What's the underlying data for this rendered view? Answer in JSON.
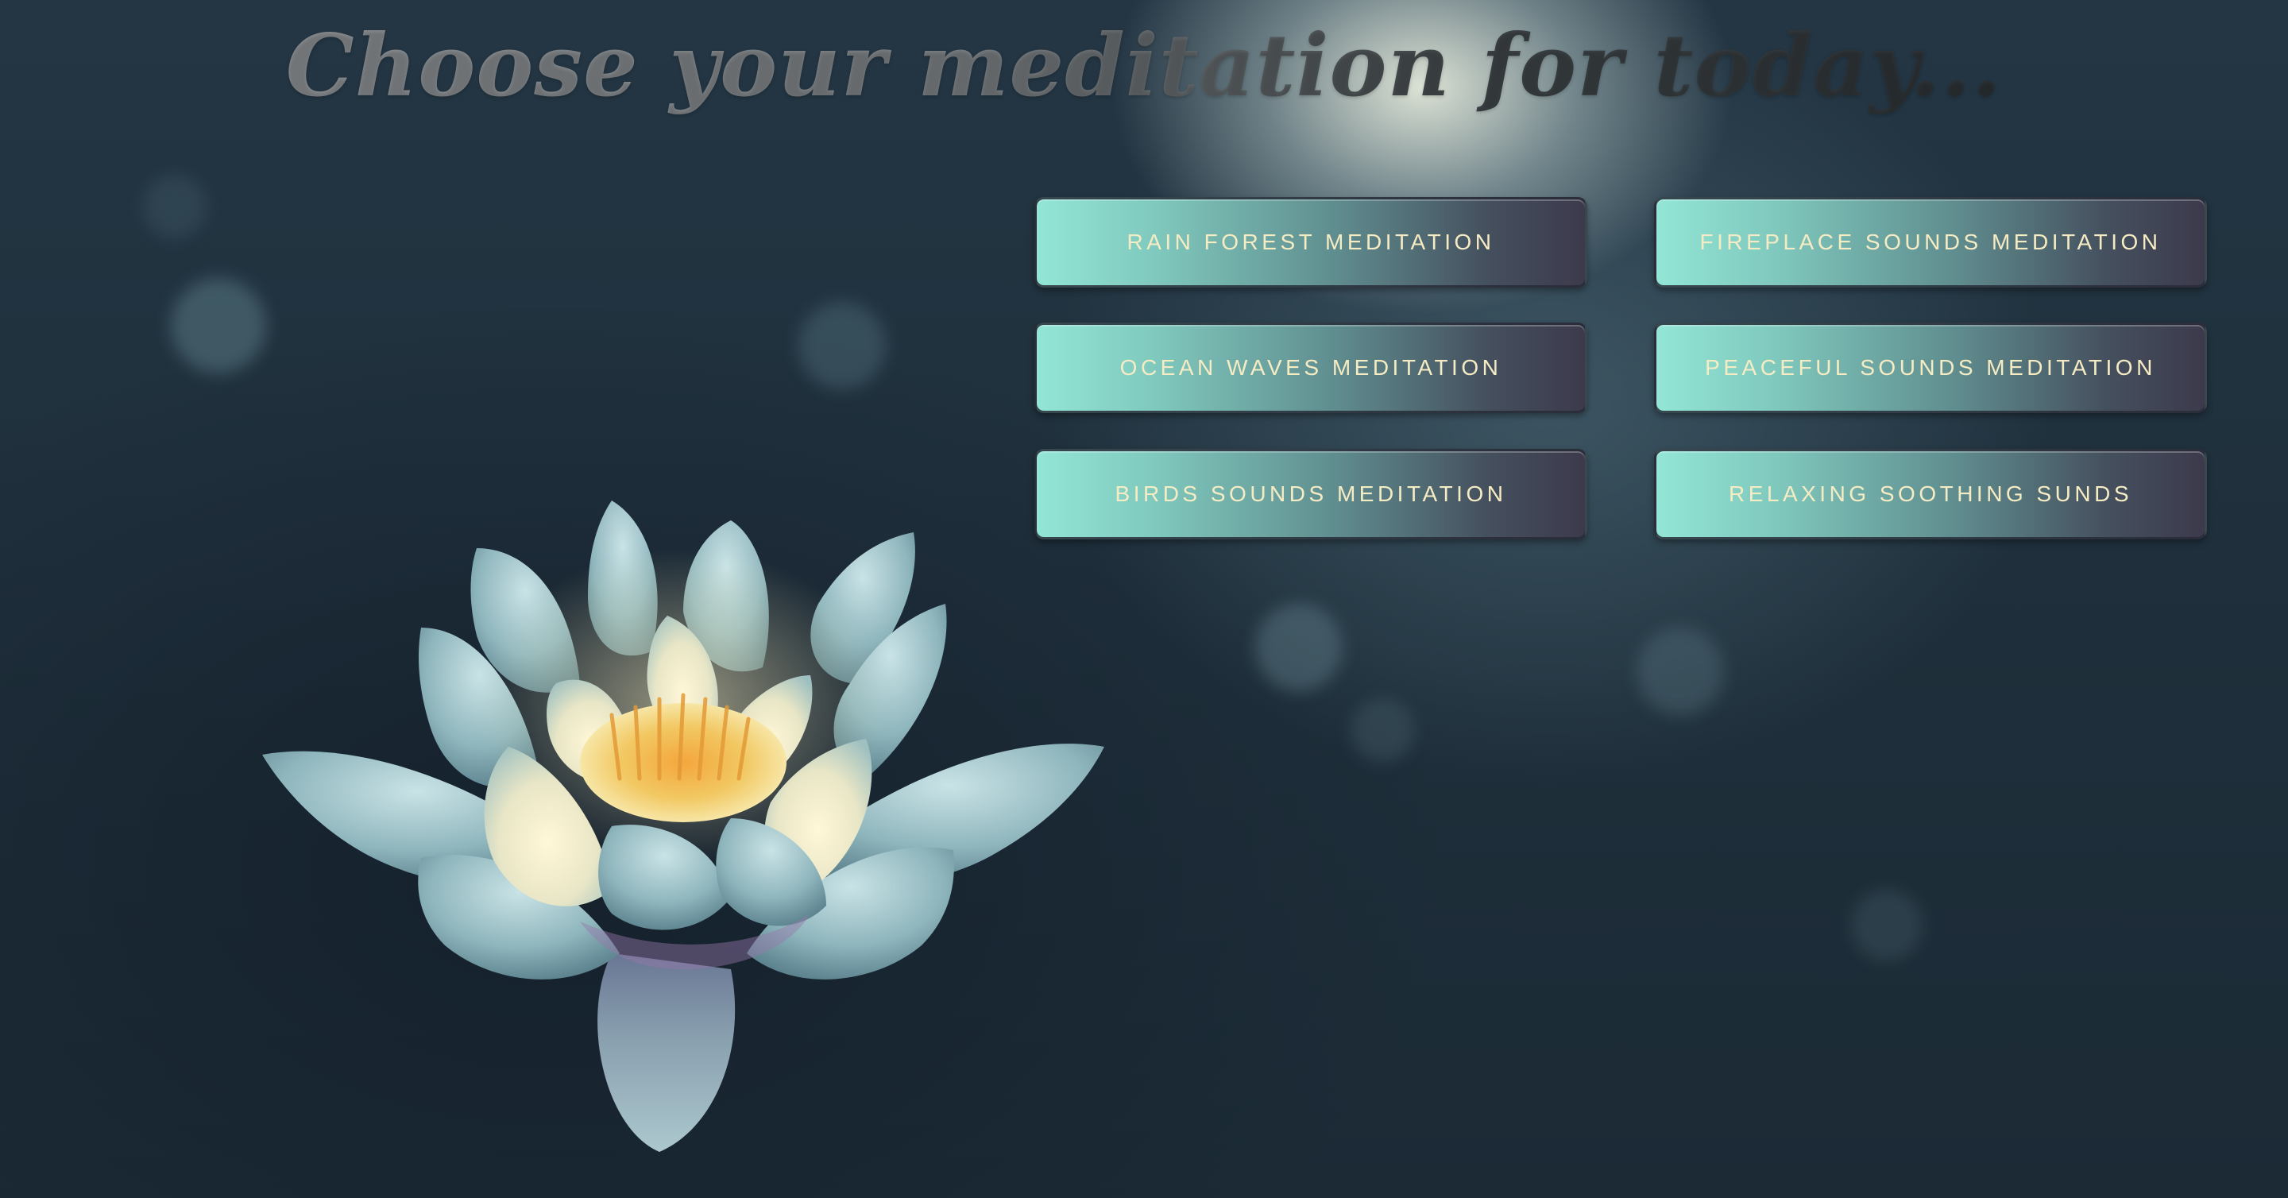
{
  "header": {
    "title": "Choose your meditation for today..."
  },
  "buttons": [
    {
      "label": "RAIN FOREST MEDITATION"
    },
    {
      "label": "FIREPLACE SOUNDS MEDITATION"
    },
    {
      "label": "OCEAN WAVES MEDITATION"
    },
    {
      "label": "PEACEFUL SOUNDS MEDITATION"
    },
    {
      "label": "BIRDS SOUNDS MEDITATION"
    },
    {
      "label": "RELAXING SOOTHING SUNDS"
    }
  ],
  "colors": {
    "button_gradient_start": "#93e6d6",
    "button_gradient_end": "#3c3a4c",
    "button_text": "#f6ecc4",
    "background": "#1c2a35"
  },
  "background_image": {
    "icon": "lotus-flower-image"
  }
}
